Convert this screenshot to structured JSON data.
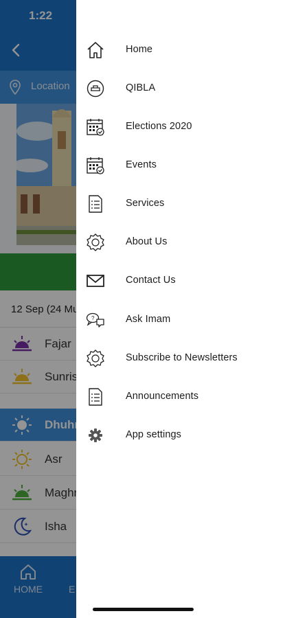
{
  "status_bar": {
    "time": "1:22"
  },
  "app": {
    "location_label": "Location",
    "date_text": "12 Sep (24 Mu",
    "prayers": [
      {
        "name": "Fajar",
        "icon": "sunrise-purple-icon"
      },
      {
        "name": "Sunris",
        "icon": "sunrise-yellow-icon"
      },
      {
        "name": "Dhuhr",
        "icon": "sun-icon"
      },
      {
        "name": "Asr",
        "icon": "sun-outline-icon"
      },
      {
        "name": "Maghr",
        "icon": "sunset-green-icon"
      },
      {
        "name": "Isha",
        "icon": "moon-icon"
      }
    ],
    "bottom_nav": {
      "home_label": "HOME",
      "second_label": "E"
    }
  },
  "drawer": {
    "items": [
      {
        "label": "Home",
        "icon": "home-icon"
      },
      {
        "label": "QIBLA",
        "icon": "qibla-icon"
      },
      {
        "label": "Elections 2020",
        "icon": "calendar-icon"
      },
      {
        "label": "Events",
        "icon": "calendar-icon"
      },
      {
        "label": "Services",
        "icon": "document-list-icon"
      },
      {
        "label": "About Us",
        "icon": "badge-icon"
      },
      {
        "label": "Contact Us",
        "icon": "envelope-icon"
      },
      {
        "label": "Ask Imam",
        "icon": "chat-bubbles-icon"
      },
      {
        "label": "Subscribe to Newsletters",
        "icon": "badge-icon"
      },
      {
        "label": "Announcements",
        "icon": "document-list-icon"
      },
      {
        "label": "App settings",
        "icon": "gear-icon"
      }
    ]
  },
  "colors": {
    "primary": "#1e73c8",
    "secondary": "#3d8fd9",
    "green": "#2f9a3b"
  }
}
